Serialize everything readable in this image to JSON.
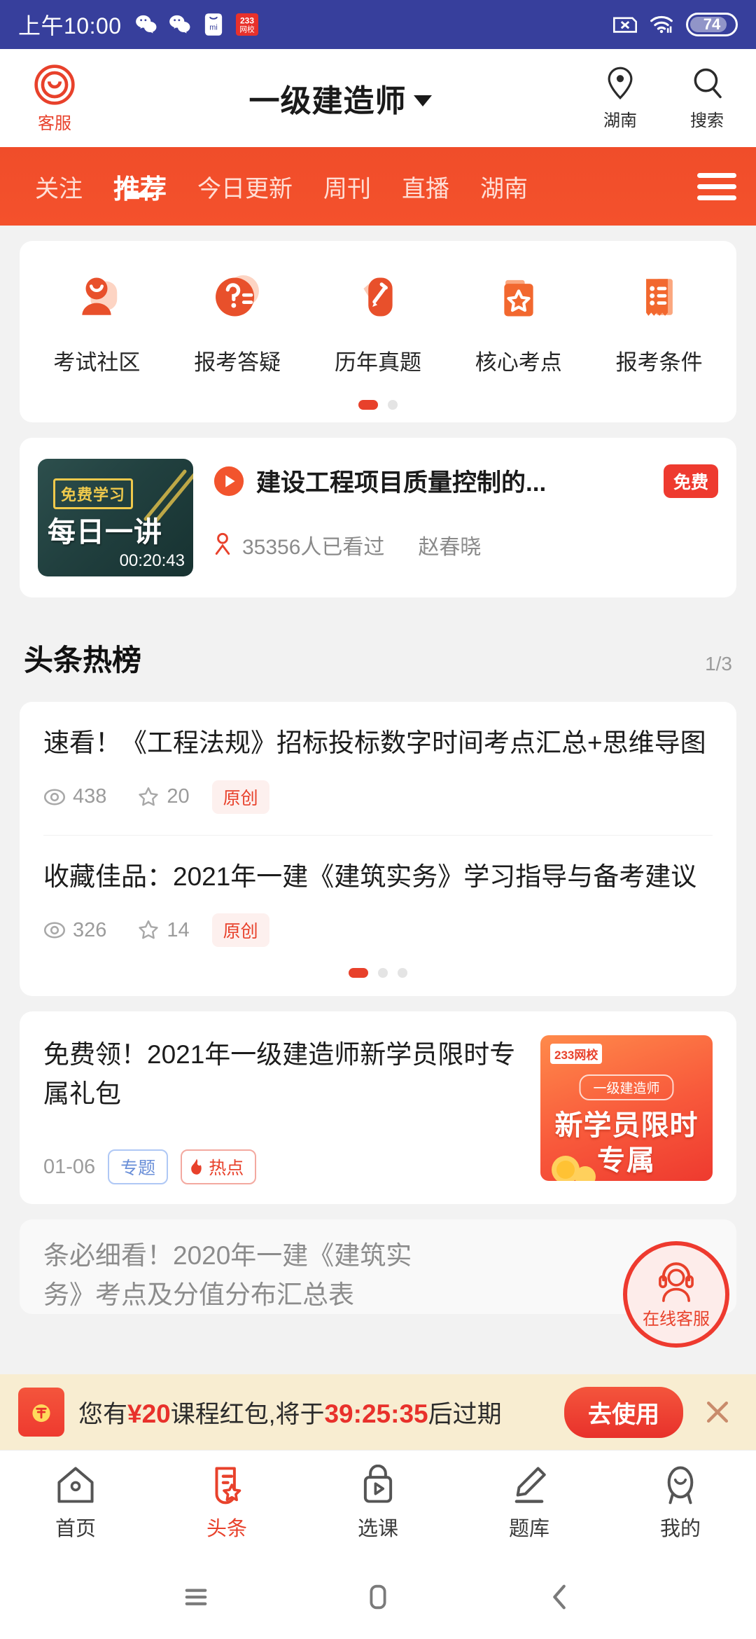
{
  "status_bar": {
    "time": "上午10:00",
    "left_icons": [
      "wechat-icon",
      "wechat-icon",
      "xiaomi-store-icon",
      "233-app-icon"
    ],
    "app_badge_text": "233",
    "app_badge_sub": "网校",
    "right_icons": [
      "sim-card-off-icon",
      "wifi-icon"
    ],
    "battery_level": "74",
    "background": "#373F9C"
  },
  "appbar": {
    "service_label": "客服",
    "title": "一级建造师",
    "location_label": "湖南",
    "search_label": "搜索"
  },
  "tabs": {
    "items": [
      {
        "label": "关注",
        "active": false
      },
      {
        "label": "推荐",
        "active": true
      },
      {
        "label": "今日更新",
        "active": false
      },
      {
        "label": "周刊",
        "active": false
      },
      {
        "label": "直播",
        "active": false
      },
      {
        "label": "湖南",
        "active": false
      }
    ],
    "menu_icon": "hamburger-icon",
    "accent": "#F4512C"
  },
  "quick_links": {
    "items": [
      {
        "label": "考试社区",
        "icon": "community-person-icon"
      },
      {
        "label": "报考答疑",
        "icon": "question-mark-icon"
      },
      {
        "label": "历年真题",
        "icon": "pencil-icon"
      },
      {
        "label": "核心考点",
        "icon": "folder-star-icon"
      },
      {
        "label": "报考条件",
        "icon": "ticket-list-icon"
      }
    ],
    "page_dots": 2,
    "active_dot": 0
  },
  "video": {
    "thumb_badge": "免费学习",
    "thumb_title": "每日一讲",
    "duration": "00:20:43",
    "title": "建设工程项目质量控制的...",
    "free_badge": "免费",
    "views": "35356人已看过",
    "author": "赵春晓"
  },
  "hot_section": {
    "title": "头条热榜",
    "page_indicator": "1/3",
    "articles": [
      {
        "title": "速看！《工程法规》招标投标数字时间考点汇总+思维导图",
        "views": "438",
        "stars": "20",
        "tag": "原创"
      },
      {
        "title": "收藏佳品：2021年一建《建筑实务》学习指导与备考建议",
        "views": "326",
        "stars": "14",
        "tag": "原创"
      }
    ],
    "page_dots": 3,
    "active_dot": 0
  },
  "gift_article": {
    "title": "免费领！2021年一级建造师新学员限时专属礼包",
    "date": "01-06",
    "tag_topic": "专题",
    "tag_hot": "热点",
    "thumb": {
      "logo": "233网校",
      "pill": "一级建造师",
      "line1": "新学员限时",
      "line2": "专属"
    }
  },
  "hidden_article": {
    "line1": "条必细看！2020年一建《建筑实",
    "line2": "务》考点及分值分布汇总表"
  },
  "floating_button": {
    "label": "在线客服",
    "icon": "headset-person-icon"
  },
  "coupon": {
    "prefix": "您有",
    "amount": "¥20",
    "middle": "课程红包,将于",
    "countdown": "39:25:35",
    "suffix": "后过期",
    "button": "去使用",
    "close_icon": "close-icon",
    "background": "#F8EDD1"
  },
  "bottom_nav": {
    "items": [
      {
        "label": "首页",
        "icon": "home-icon",
        "active": false
      },
      {
        "label": "头条",
        "icon": "headline-star-icon",
        "active": true
      },
      {
        "label": "选课",
        "icon": "bag-play-icon",
        "active": false
      },
      {
        "label": "题库",
        "icon": "pencil-underline-icon",
        "active": false
      },
      {
        "label": "我的",
        "icon": "person-icon",
        "active": false
      }
    ],
    "active_color": "#E8412B"
  },
  "android_nav": {
    "recents_icon": "recents-icon",
    "home_icon": "home-square-icon",
    "back_icon": "back-chevron-icon"
  }
}
